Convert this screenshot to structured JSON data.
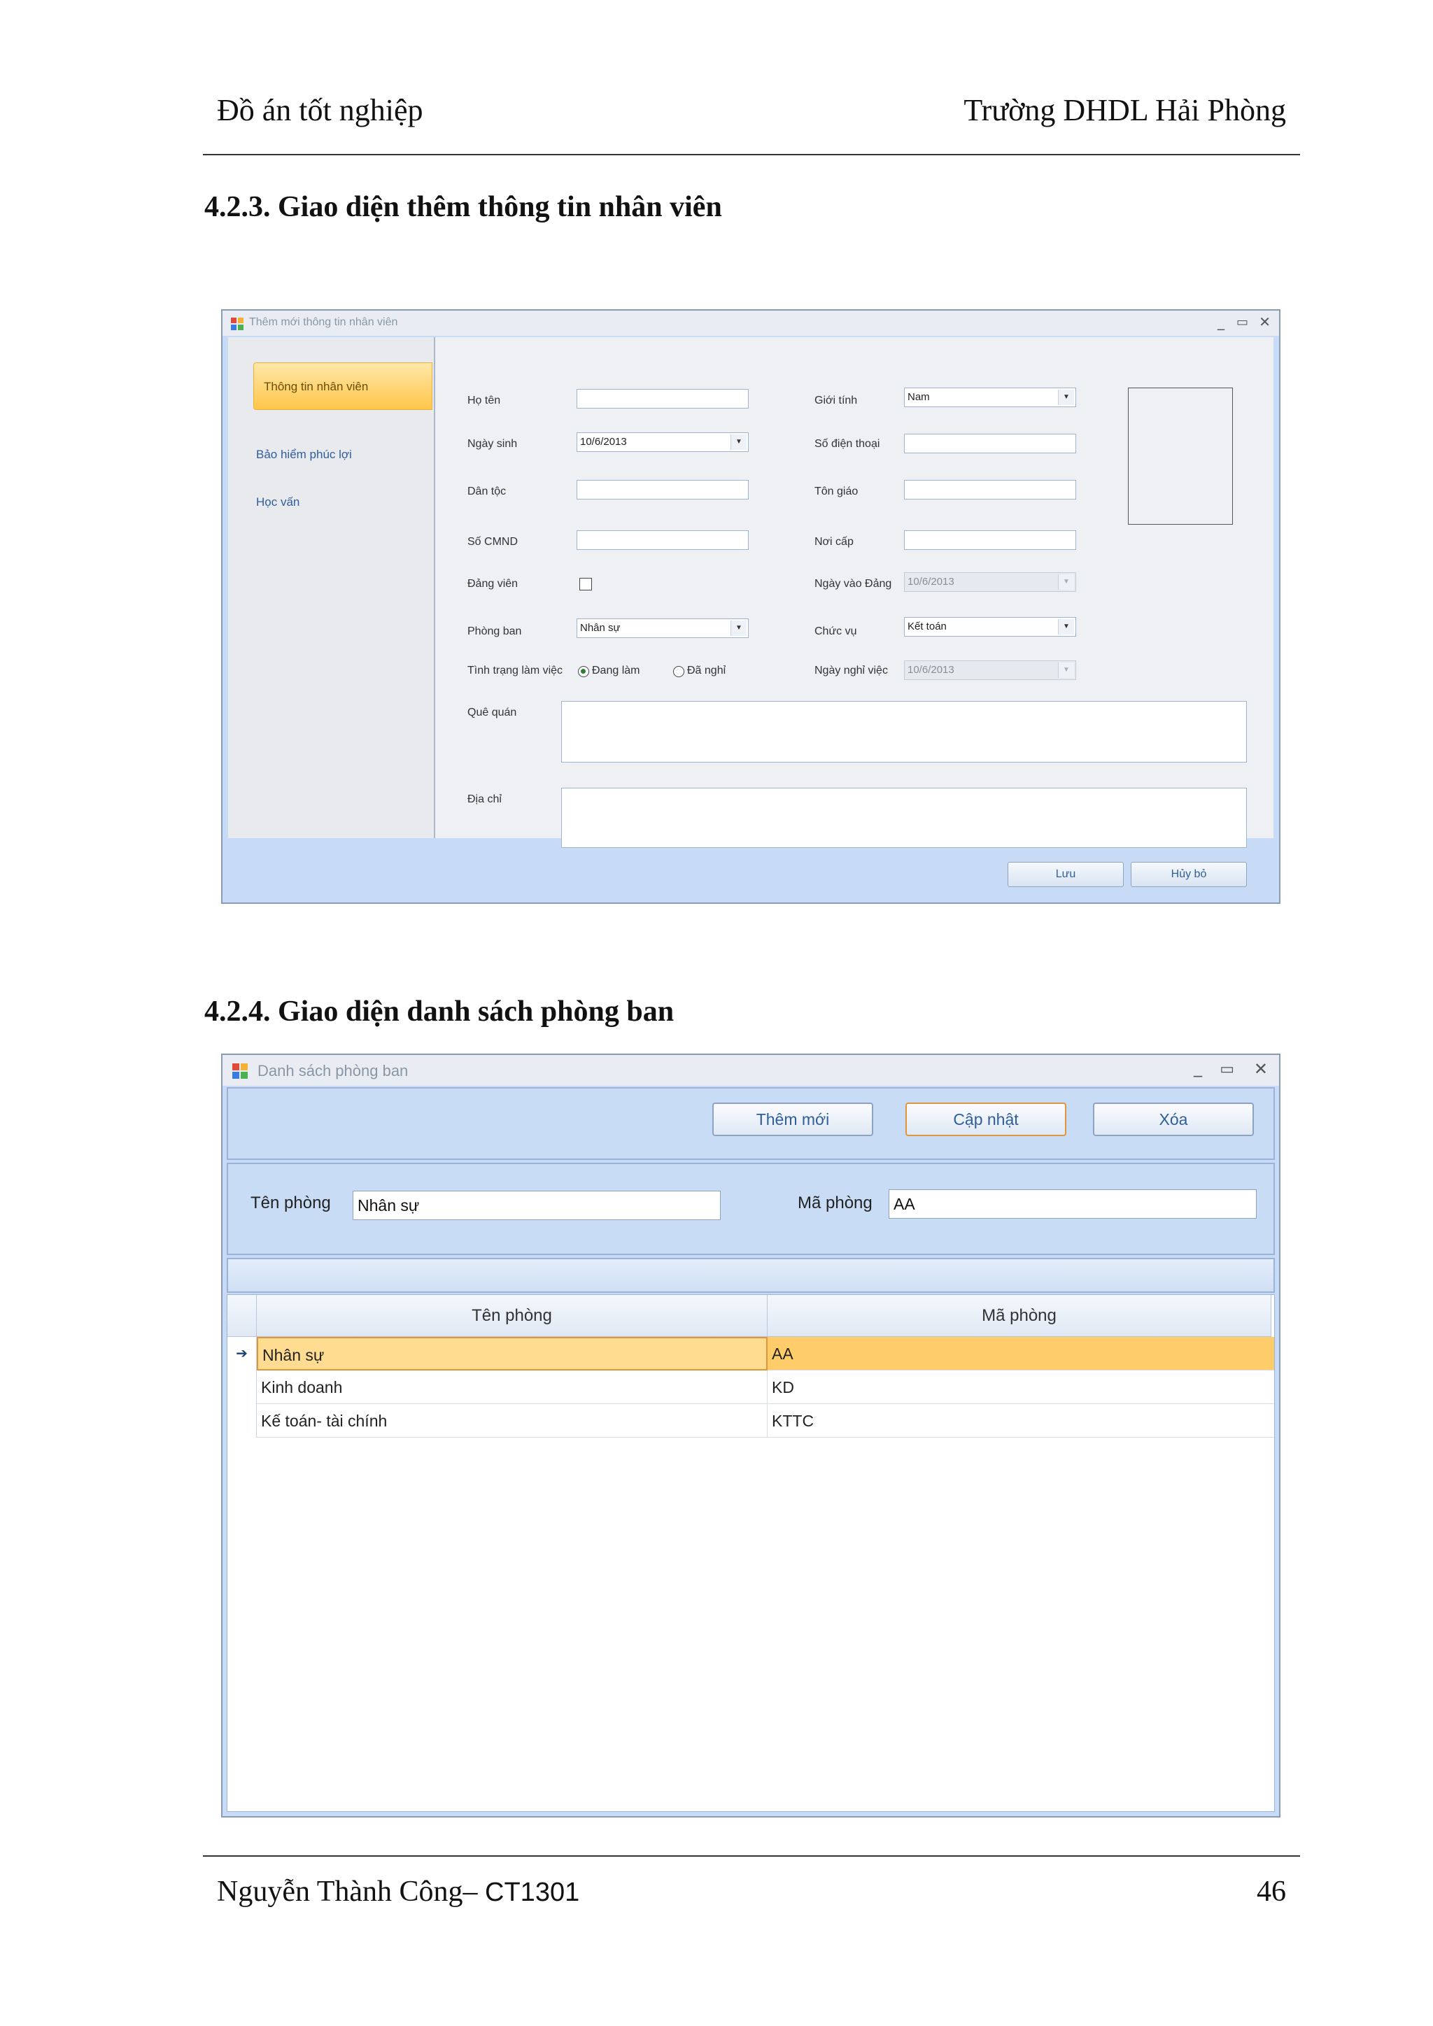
{
  "page_header": {
    "left": "Đồ án tốt nghiệp",
    "right": "Trường DHDL Hải Phòng"
  },
  "sections": [
    {
      "title": "4.2.3.  Giao diện thêm thông tin nhân viên"
    },
    {
      "title": "4.2.4.  Giao diện danh sách phòng ban"
    }
  ],
  "form1": {
    "title": "Thêm mới thông tin nhân viên",
    "sidebar": [
      "Thông tin nhân viên",
      "Bảo hiểm phúc lợi",
      "Học vấn"
    ],
    "labels": {
      "ho_ten": "Họ tên",
      "ngay_sinh": "Ngày sinh",
      "dan_toc": "Dân tộc",
      "so_cmnd": "Số CMND",
      "dang_vien": "Đảng viên",
      "phong_ban": "Phòng ban",
      "tinh_trang": "Tình trạng làm việc",
      "que_quan": "Quê quán",
      "dia_chi": "Địa chỉ",
      "gioi_tinh": "Giới tính",
      "so_dien_thoai": "Số điện thoại",
      "ton_giao": "Tôn giáo",
      "noi_cap": "Nơi cấp",
      "ngay_vao_dang": "Ngày vào Đảng",
      "chuc_vu": "Chức vụ",
      "ngay_nghi_viec": "Ngày nghỉ việc"
    },
    "values": {
      "ngay_sinh": "10/6/2013",
      "phong_ban": "Nhân sự",
      "gioi_tinh": "Nam",
      "ngay_vao_dang": "10/6/2013",
      "chuc_vu": "Kết toán",
      "ngay_nghi_viec": "10/6/2013"
    },
    "radio": {
      "dang_lam": "Đang làm",
      "da_nghi": "Đã nghỉ"
    },
    "buttons": {
      "luu": "Lưu",
      "huy_bo": "Hủy bỏ"
    }
  },
  "form2": {
    "title": "Danh sách phòng ban",
    "buttons": {
      "them_moi": "Thêm mới",
      "cap_nhat": "Cập nhật",
      "xoa": "Xóa"
    },
    "labels": {
      "ten_phong": "Tên phòng",
      "ma_phong": "Mã phòng"
    },
    "values": {
      "ten_phong": "Nhân sự",
      "ma_phong": "AA"
    },
    "columns": [
      "Tên phòng",
      "Mã phòng"
    ],
    "rows": [
      [
        "Nhân sự",
        "AA"
      ],
      [
        "Kinh doanh",
        "KD"
      ],
      [
        "Kế toán- tài chính",
        "KTTC"
      ]
    ]
  },
  "footer": {
    "author": "Nguyễn Thành Công–",
    "class_code": "CT1301",
    "page_number": "46"
  }
}
